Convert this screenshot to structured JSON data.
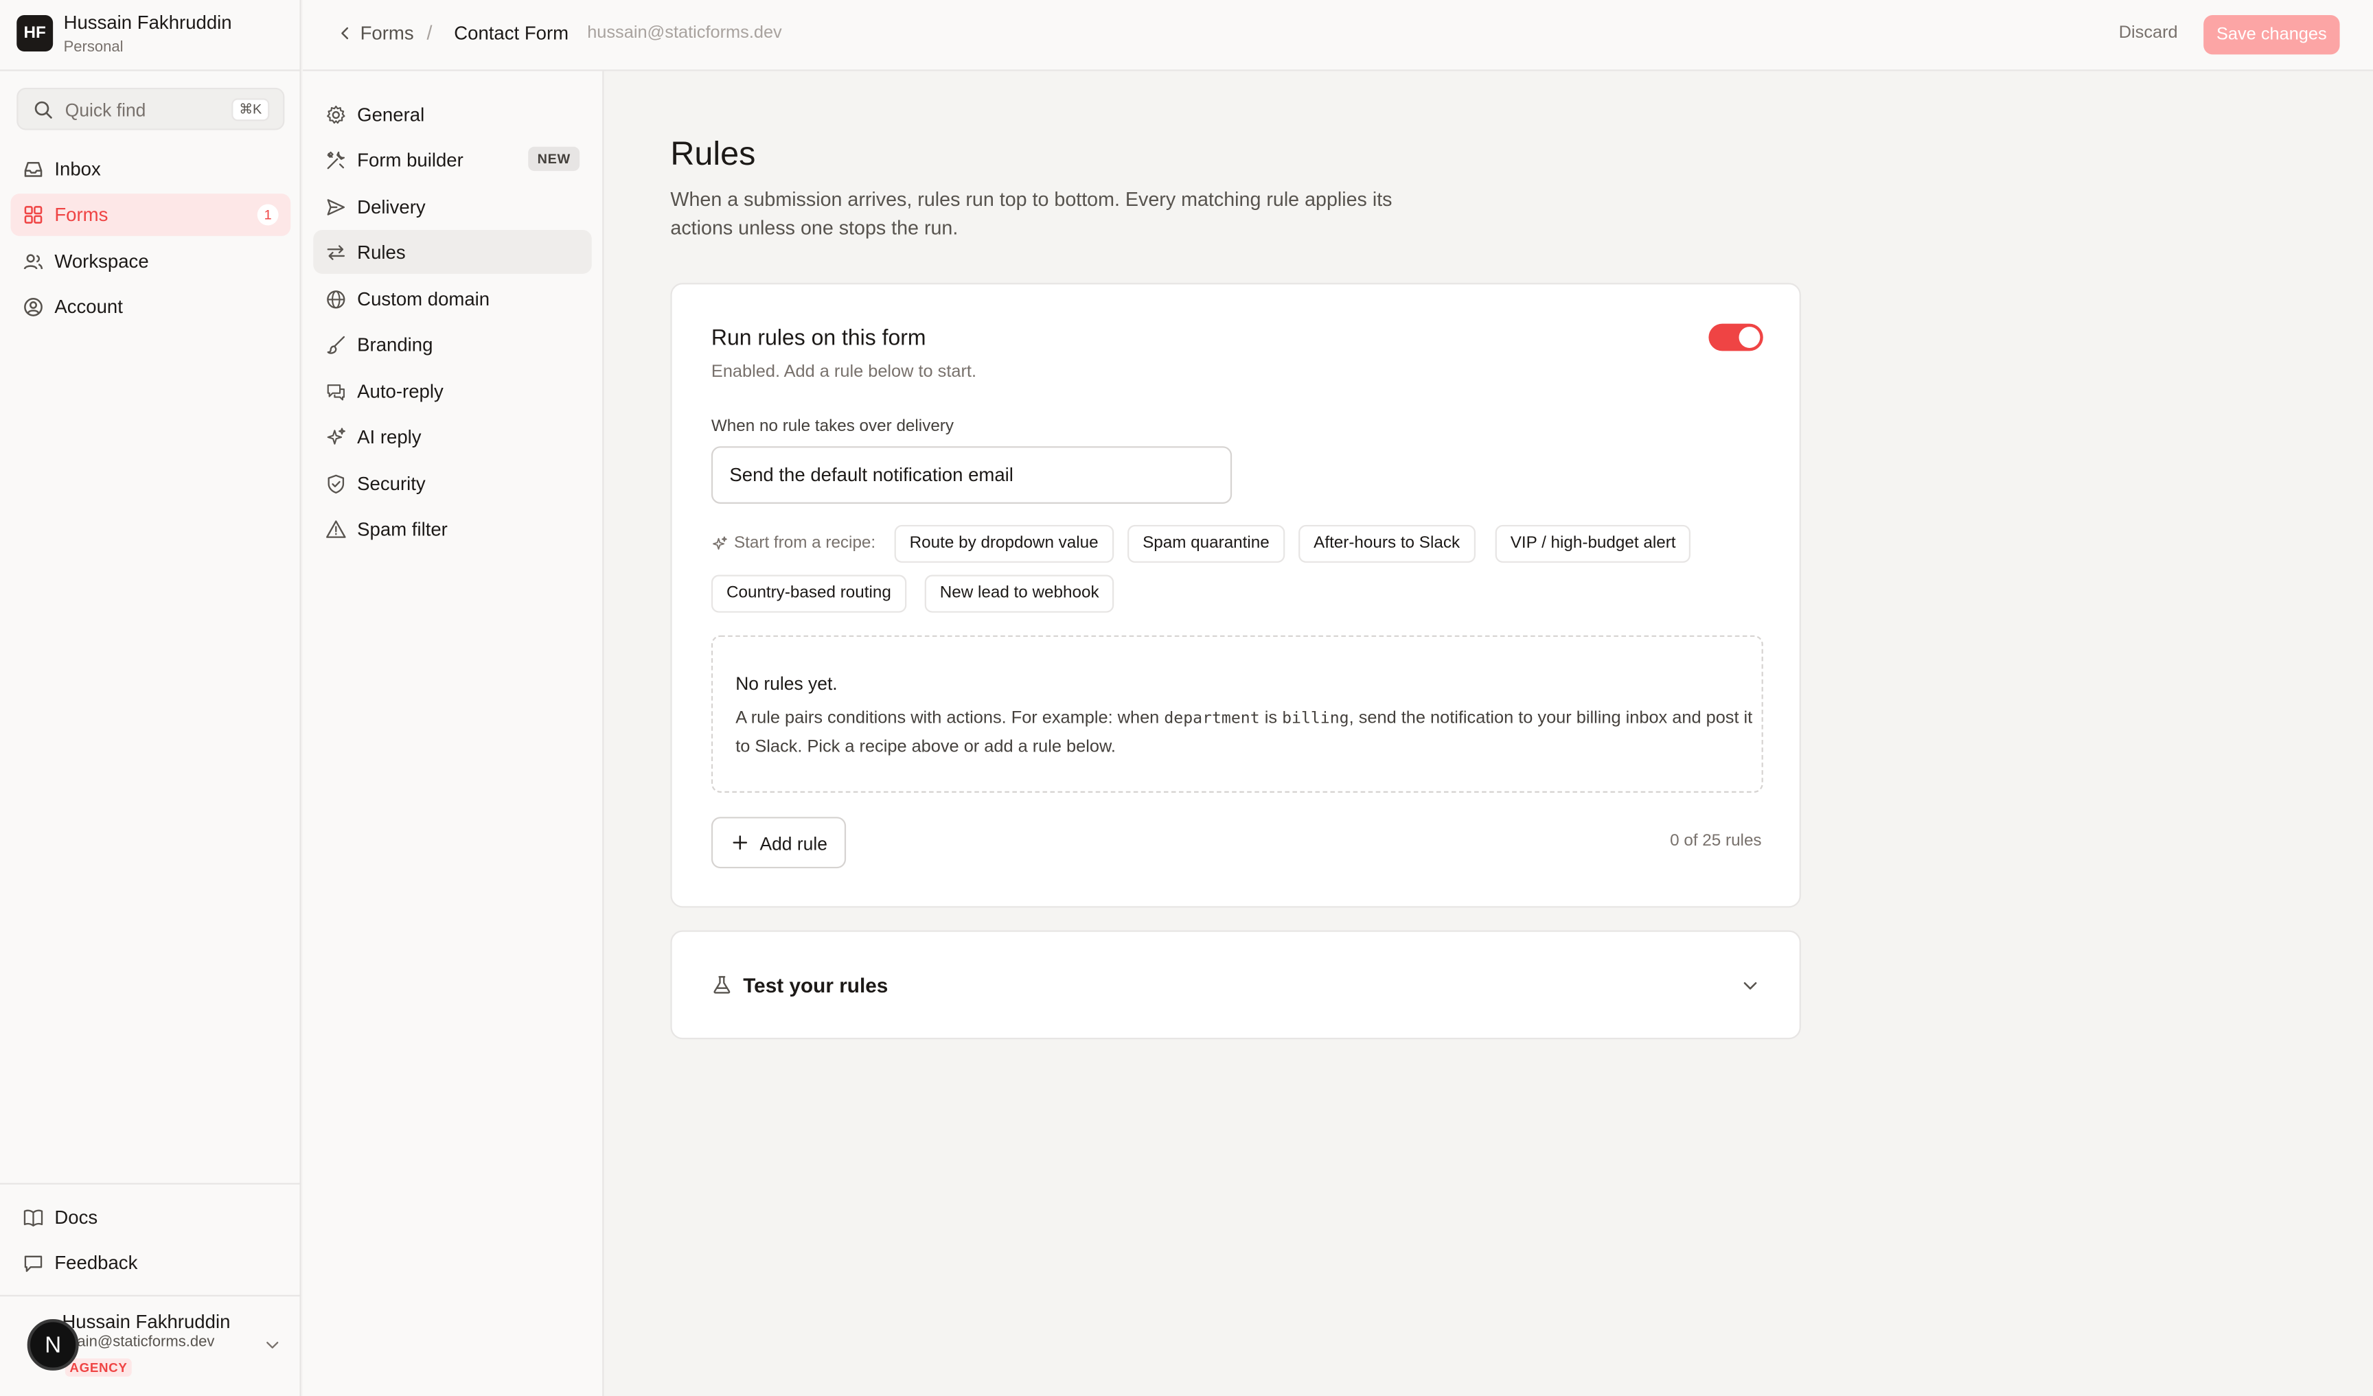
{
  "workspace": {
    "initials": "HF",
    "name": "Hussain Fakhruddin",
    "plan": "Personal"
  },
  "quick_find": {
    "label": "Quick find",
    "shortcut": "⌘K"
  },
  "nav": {
    "items": [
      {
        "label": "Inbox",
        "icon": "inbox-icon"
      },
      {
        "label": "Forms",
        "icon": "grid-icon",
        "badge": "1",
        "active": true
      },
      {
        "label": "Workspace",
        "icon": "users-icon"
      },
      {
        "label": "Account",
        "icon": "user-circle-icon"
      }
    ],
    "footer": [
      {
        "label": "Docs",
        "icon": "book-icon"
      },
      {
        "label": "Feedback",
        "icon": "message-icon"
      }
    ]
  },
  "user": {
    "initial": "N",
    "name": "Hussain Fakhruddin",
    "email": "ssain@staticforms.dev",
    "badge": "AGENCY"
  },
  "breadcrumb": {
    "parent": "Forms",
    "separator": "/",
    "current": "Contact Form",
    "email": "hussain@staticforms.dev"
  },
  "actions": {
    "discard": "Discard",
    "save": "Save changes"
  },
  "subnav": {
    "items": [
      {
        "label": "General",
        "icon": "gear-icon"
      },
      {
        "label": "Form builder",
        "icon": "tools-icon",
        "badge": "NEW"
      },
      {
        "label": "Delivery",
        "icon": "send-icon"
      },
      {
        "label": "Rules",
        "icon": "arrows-icon",
        "active": true
      },
      {
        "label": "Custom domain",
        "icon": "globe-icon"
      },
      {
        "label": "Branding",
        "icon": "brush-icon"
      },
      {
        "label": "Auto-reply",
        "icon": "chat-icon"
      },
      {
        "label": "AI reply",
        "icon": "sparkle-icon"
      },
      {
        "label": "Security",
        "icon": "shield-icon"
      },
      {
        "label": "Spam filter",
        "icon": "warning-icon"
      }
    ]
  },
  "page": {
    "title": "Rules",
    "description": "When a submission arrives, rules run top to bottom. Every matching rule applies its actions unless one stops the run."
  },
  "rules_card": {
    "title": "Run rules on this form",
    "subtitle": "Enabled. Add a rule below to start.",
    "toggle_on": true,
    "fallback_label": "When no rule takes over delivery",
    "fallback_value": "Send the default notification email",
    "recipe_label": "Start from a recipe:",
    "recipes": [
      "Route by dropdown value",
      "Spam quarantine",
      "After-hours to Slack",
      "VIP / high-budget alert",
      "Country-based routing",
      "New lead to webhook"
    ],
    "empty_title": "No rules yet.",
    "empty_body_1": "A rule pairs conditions with actions. For example: when ",
    "empty_code_1": "department",
    "empty_body_2": " is ",
    "empty_code_2": "billing",
    "empty_body_3": ", send the notification to your billing inbox and post it to Slack. Pick a recipe above or add a rule below.",
    "add_rule": "Add rule",
    "count": "0 of 25 rules"
  },
  "test_card": {
    "title": "Test your rules"
  },
  "colors": {
    "accent": "#ef4444",
    "accent_soft": "#fde7e7",
    "save_disabled": "#fca5a5"
  }
}
